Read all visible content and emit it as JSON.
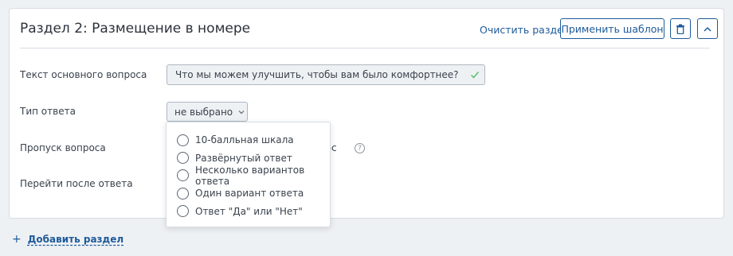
{
  "section": {
    "title": "Раздел 2: Размещение в номере",
    "clear_label": "Очистить раздел",
    "template_label": "Применить шаблон"
  },
  "fields": {
    "question_label": "Текст основного вопроса",
    "question_value": "Что мы можем улучшить, чтобы вам было комфортнее?",
    "answer_type_label": "Тип ответа",
    "answer_type_value": "не выбрано",
    "skip_label": "Пропуск вопроса",
    "skip_partial_text": "рос",
    "goto_label": "Перейти после ответа"
  },
  "dropdown": {
    "options": [
      "10-балльная шкала",
      "Развёрнутый ответ",
      "Несколько вариантов ответа",
      "Один вариант ответа",
      "Ответ \"Да\" или \"Нет\""
    ]
  },
  "footer": {
    "add_section_label": "Добавить раздел"
  },
  "icons": {
    "delete": "trash-icon",
    "collapse": "chevron-up-icon",
    "valid": "check-icon",
    "help": "question-circle-icon"
  },
  "colors": {
    "accent": "#1e5a9a",
    "valid": "#5bbf6a",
    "background": "#eef1f4"
  }
}
